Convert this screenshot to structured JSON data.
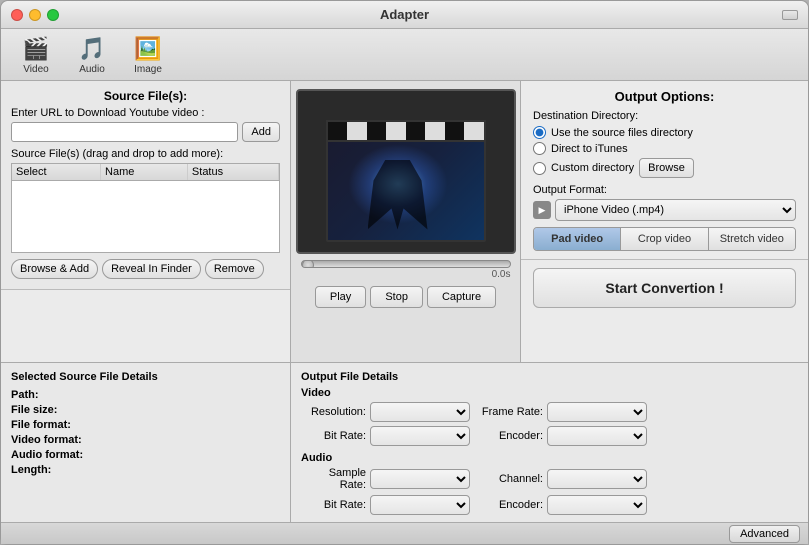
{
  "window": {
    "title": "Adapter"
  },
  "toolbar": {
    "buttons": [
      {
        "label": "Video",
        "icon": "🎬"
      },
      {
        "label": "Audio",
        "icon": "🎵"
      },
      {
        "label": "Image",
        "icon": "🖼️"
      }
    ]
  },
  "source": {
    "title": "Source File(s):",
    "url_label": "Enter URL to Download Youtube video :",
    "url_placeholder": "",
    "add_btn": "Add",
    "files_label": "Source File(s) (drag and drop to add more):",
    "table_headers": [
      "Select",
      "Name",
      "Status"
    ],
    "browse_btn": "Browse & Add",
    "reveal_btn": "Reveal In Finder",
    "remove_btn": "Remove"
  },
  "details": {
    "title": "Selected Source File Details",
    "fields": [
      {
        "label": "Path:",
        "value": ""
      },
      {
        "label": "File size:",
        "value": ""
      },
      {
        "label": "File format:",
        "value": ""
      },
      {
        "label": "Video format:",
        "value": ""
      },
      {
        "label": "Audio format:",
        "value": ""
      },
      {
        "label": "Length:",
        "value": ""
      }
    ]
  },
  "preview": {
    "time": "0.0s",
    "play_btn": "Play",
    "stop_btn": "Stop",
    "capture_btn": "Capture"
  },
  "output_options": {
    "title": "Output Options:",
    "dest_label": "Destination Directory:",
    "radio_options": [
      {
        "label": "Use the source files directory",
        "checked": true
      },
      {
        "label": "Direct to iTunes",
        "checked": false
      },
      {
        "label": "Custom directory",
        "checked": false
      }
    ],
    "browse_btn": "Browse",
    "format_label": "Output Format:",
    "format_value": "iPhone Video (.mp4)",
    "pad_btns": [
      "Pad video",
      "Crop video",
      "Stretch video"
    ],
    "active_pad": 0,
    "start_btn": "Start Convertion !"
  },
  "output_details": {
    "title": "Output File Details",
    "video_label": "Video",
    "audio_label": "Audio",
    "video_fields": [
      {
        "label": "Resolution:",
        "value": ""
      },
      {
        "label": "Bit Rate:",
        "value": ""
      },
      {
        "label": "Frame Rate:",
        "value": ""
      },
      {
        "label": "Encoder:",
        "value": ""
      }
    ],
    "audio_fields": [
      {
        "label": "Sample Rate:",
        "value": ""
      },
      {
        "label": "Bit Rate:",
        "value": ""
      },
      {
        "label": "Channel:",
        "value": ""
      },
      {
        "label": "Encoder:",
        "value": ""
      }
    ]
  },
  "status_bar": {
    "advanced_btn": "Advanced"
  }
}
